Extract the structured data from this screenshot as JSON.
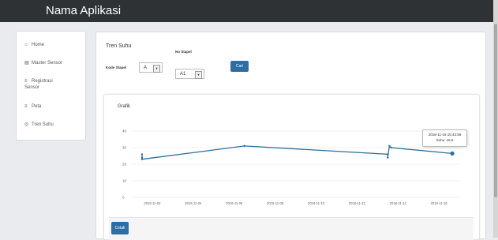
{
  "header": {
    "app_title": "Nama Aplikasi"
  },
  "sidebar": {
    "items": [
      {
        "label": "Home",
        "icon": "home-icon"
      },
      {
        "label": "Master Sensor",
        "icon": "list-icon"
      },
      {
        "label": "Registrasi",
        "label2": "Sensor",
        "icon": "list-icon"
      },
      {
        "label": "Peta",
        "icon": "list-icon"
      },
      {
        "label": "Tren Suhu",
        "icon": "circle-icon"
      }
    ]
  },
  "main": {
    "section_title": "Tren Suhu",
    "kode_stapel_label": "Kode Stapel",
    "kode_stapel_value": "A",
    "no_stapel_label": "No Stapel",
    "no_stapel_value": "A1",
    "search_button": "Cari",
    "chart_title": "Grafik",
    "print_button": "Cetak",
    "tooltip": {
      "line1": "2018-11-16 15:43:59",
      "line2": "Suhu: 26.5"
    }
  },
  "chart_data": {
    "type": "line",
    "ylim": [
      0,
      40
    ],
    "yticks": [
      "0",
      "10",
      "20",
      "30",
      "40"
    ],
    "xticks": [
      "2018-11-02",
      "2018-11-04",
      "2018-11-06",
      "2018-11-08",
      "2018-11-10",
      "2018-11-12",
      "2018-11-14",
      "2018-11-16"
    ],
    "series": [
      {
        "x": [
          "2018-11-01 12:00",
          "2018-11-01 12:00",
          "2018-11-01 12:00",
          "2018-11-06 12:00",
          "2018-11-13 12:00",
          "2018-11-13 12:00",
          "2018-11-13 14:00",
          "2018-11-13 16:00",
          "2018-11-16 15:43"
        ],
        "values": [
          24,
          26,
          23,
          31,
          26,
          24,
          31,
          30,
          26.5
        ],
        "color": "#2f6f99"
      }
    ]
  }
}
